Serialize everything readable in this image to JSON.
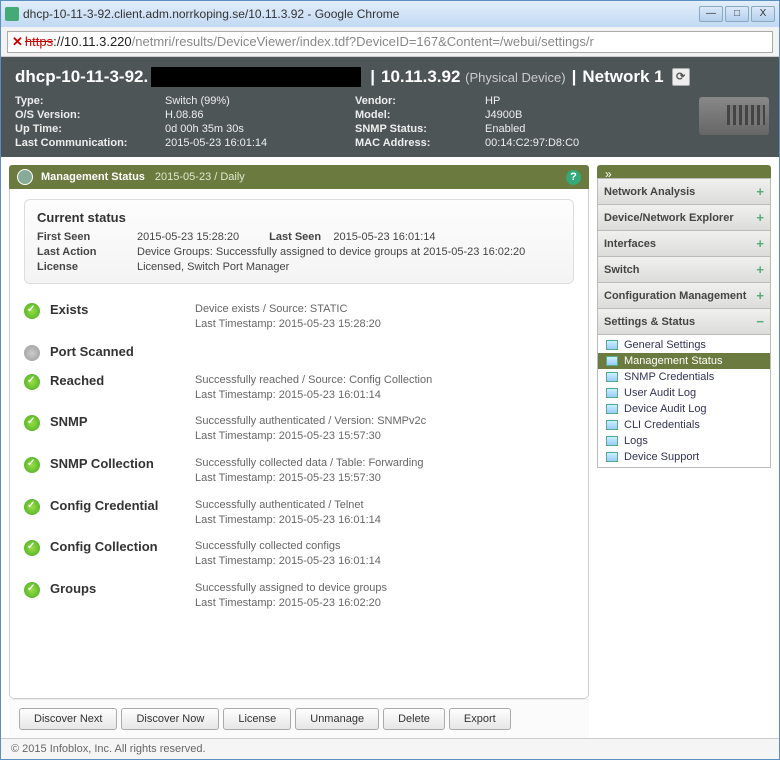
{
  "window": {
    "title": "dhcp-10-11-3-92.client.adm.norrkoping.se/10.11.3.92 - Google Chrome"
  },
  "address": {
    "https": "https",
    "domain": "://10.11.3.220",
    "path": "/netmri/results/DeviceViewer/index.tdf?DeviceID=167&Content=/webui/settings/r"
  },
  "header": {
    "hostname_prefix": "dhcp-10-11-3-92.",
    "ip": "10.11.3.92",
    "physical": "(Physical Device)",
    "network": "Network 1",
    "fields": {
      "type_k": "Type:",
      "type_v": "Switch (99%)",
      "os_k": "O/S Version:",
      "os_v": "H.08.86",
      "uptime_k": "Up Time:",
      "uptime_v": "0d 00h 35m 30s",
      "lastcomm_k": "Last Communication:",
      "lastcomm_v": "2015-05-23 16:01:14",
      "vendor_k": "Vendor:",
      "vendor_v": "HP",
      "model_k": "Model:",
      "model_v": "J4900B",
      "snmp_k": "SNMP Status:",
      "snmp_v": "Enabled",
      "mac_k": "MAC Address:",
      "mac_v": "00:14:C2:97:D8:C0"
    }
  },
  "panel": {
    "title": "Management Status",
    "date": "2015-05-23 / Daily",
    "help": "?"
  },
  "current": {
    "heading": "Current status",
    "firstseen_k": "First Seen",
    "firstseen_v": "2015-05-23 15:28:20",
    "lastseen_k": "Last Seen",
    "lastseen_v": "2015-05-23 16:01:14",
    "lastaction_k": "Last Action",
    "lastaction_v": "Device Groups: Successfully assigned to device groups at 2015-05-23 16:02:20",
    "license_k": "License",
    "license_v": "Licensed, Switch Port Manager"
  },
  "statuses": [
    {
      "name": "Exists",
      "ok": true,
      "line1": "Device exists / Source: STATIC",
      "line2": "Last Timestamp: 2015-05-23 15:28:20"
    },
    {
      "name": "Port Scanned",
      "ok": false,
      "line1": "",
      "line2": ""
    },
    {
      "name": "Reached",
      "ok": true,
      "line1": "Successfully reached / Source: Config Collection",
      "line2": "Last Timestamp: 2015-05-23 16:01:14"
    },
    {
      "name": "SNMP",
      "ok": true,
      "line1": "Successfully authenticated / Version: SNMPv2c",
      "line2": "Last Timestamp: 2015-05-23 15:57:30"
    },
    {
      "name": "SNMP Collection",
      "ok": true,
      "line1": "Successfully collected data / Table: Forwarding",
      "line2": "Last Timestamp: 2015-05-23 15:57:30"
    },
    {
      "name": "Config Credential",
      "ok": true,
      "line1": "Successfully authenticated / Telnet",
      "line2": "Last Timestamp: 2015-05-23 16:01:14"
    },
    {
      "name": "Config Collection",
      "ok": true,
      "line1": "Successfully collected configs",
      "line2": "Last Timestamp: 2015-05-23 16:01:14"
    },
    {
      "name": "Groups",
      "ok": true,
      "line1": "Successfully assigned to device groups",
      "line2": "Last Timestamp: 2015-05-23 16:02:20"
    }
  ],
  "buttons": {
    "discover_next": "Discover Next",
    "discover_now": "Discover Now",
    "license": "License",
    "unmanage": "Unmanage",
    "delete": "Delete",
    "export": "Export"
  },
  "sidebar": {
    "chevron": "»",
    "sections": [
      {
        "label": "Network Analysis"
      },
      {
        "label": "Device/Network Explorer"
      },
      {
        "label": "Interfaces"
      },
      {
        "label": "Switch"
      },
      {
        "label": "Configuration Management"
      },
      {
        "label": "Settings & Status"
      }
    ],
    "items": [
      {
        "label": "General Settings"
      },
      {
        "label": "Management Status"
      },
      {
        "label": "SNMP Credentials"
      },
      {
        "label": "User Audit Log"
      },
      {
        "label": "Device Audit Log"
      },
      {
        "label": "CLI Credentials"
      },
      {
        "label": "Logs"
      },
      {
        "label": "Device Support"
      }
    ]
  },
  "footer": "© 2015 Infoblox, Inc. All rights reserved."
}
